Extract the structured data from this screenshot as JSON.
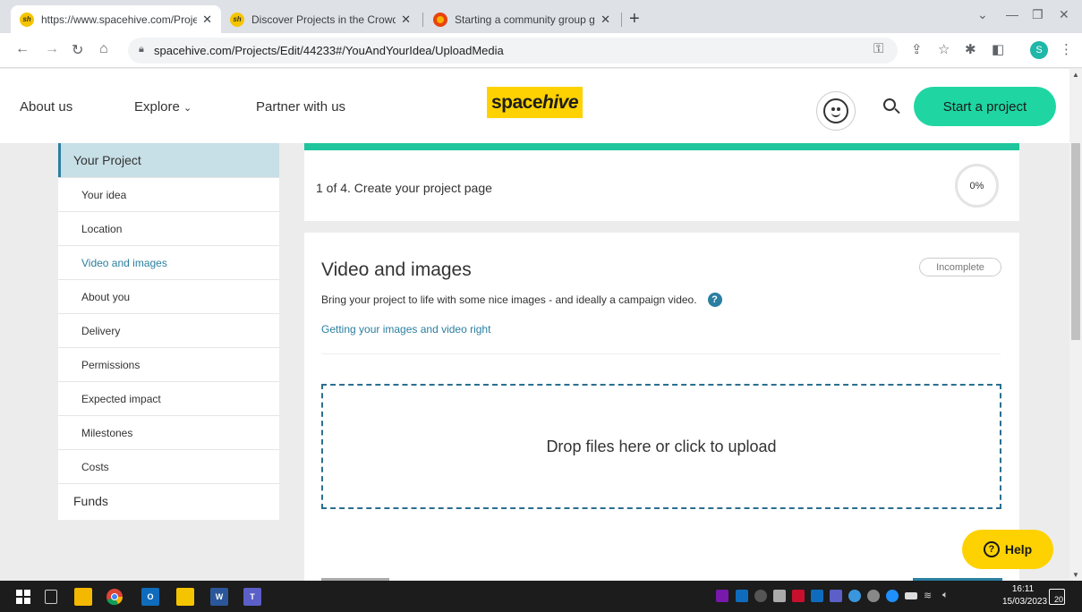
{
  "browser": {
    "tabs": [
      {
        "title": "https://www.spacehive.com/Proje",
        "favicon": "sh"
      },
      {
        "title": "Discover Projects in the Crowdfu",
        "favicon": "sh"
      },
      {
        "title": "Starting a community group guid",
        "favicon": "circle"
      }
    ],
    "url": "spacehive.com/Projects/Edit/44233#/YouAndYourIdea/UploadMedia",
    "profile_initial": "S"
  },
  "header": {
    "about_us": "About us",
    "explore": "Explore",
    "partner": "Partner with us",
    "logo_space": "space",
    "logo_hive": "hive",
    "start_project": "Start a project"
  },
  "sidebar": {
    "section_project": "Your Project",
    "items": [
      {
        "label": "Your idea"
      },
      {
        "label": "Location"
      },
      {
        "label": "Video and images"
      },
      {
        "label": "About you"
      },
      {
        "label": "Delivery"
      },
      {
        "label": "Permissions"
      },
      {
        "label": "Expected impact"
      },
      {
        "label": "Milestones"
      },
      {
        "label": "Costs"
      }
    ],
    "section_funds": "Funds"
  },
  "progress": {
    "step_text": "1 of 4. Create your project page",
    "percent": "0%"
  },
  "main": {
    "title": "Video and images",
    "status": "Incomplete",
    "description": "Bring your project to life with some nice images - and ideally a campaign video.",
    "guide_link": "Getting your images and video right",
    "dropzone": "Drop files here or click to upload"
  },
  "help": {
    "label": "Help"
  },
  "taskbar": {
    "time": "16:11",
    "date": "15/03/2023",
    "notifications": "20"
  },
  "colors": {
    "accent_green": "#1fd6a3",
    "brand_yellow": "#fdd200",
    "link_blue": "#2b7fa0"
  }
}
